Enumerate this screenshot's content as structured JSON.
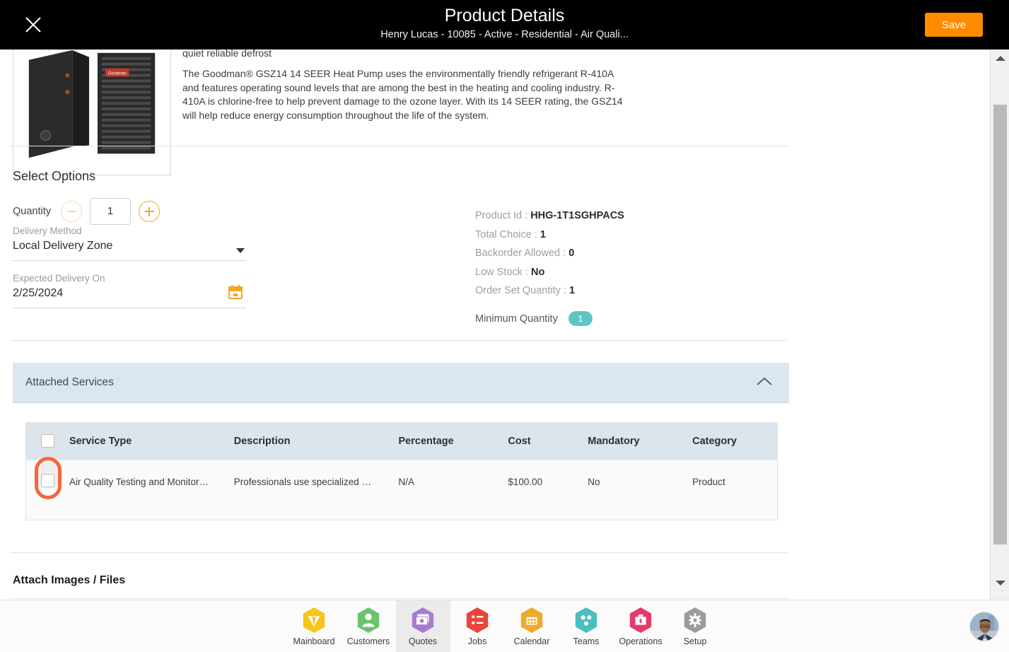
{
  "header": {
    "title": "Product Details",
    "subtitle": "Henry Lucas - 10085 - Active - Residential - Air Quali...",
    "close_icon": "close-icon",
    "save_label": "Save",
    "accent_color": "#ff8c00",
    "background": "#000000"
  },
  "product": {
    "description_clipped": "quiet reliable defrost",
    "description": "The Goodman® GSZ14 14 SEER Heat Pump uses the environmentally friendly refrigerant R-410A and features operating sound levels that are among the best in the heating and cooling industry. R-410A is chlorine-free to help prevent damage to the ozone layer. With its 14 SEER rating, the GSZ14 will help reduce energy consumption throughout the life of the system.",
    "image_alt": "heat-pump-condenser-photo"
  },
  "select_options": {
    "title": "Select Options",
    "quantity_label": "Quantity",
    "quantity_value": "1",
    "decrement_icon": "minus-icon",
    "increment_icon": "plus-icon",
    "delivery_method_label": "Delivery Method",
    "delivery_method_value": "Local Delivery Zone",
    "delivery_method_caret": "chevron-down-icon",
    "expected_delivery_label": "Expected Delivery On",
    "expected_delivery_value": "2/25/2024",
    "calendar_icon": "calendar-icon"
  },
  "info_panel": {
    "lines": [
      {
        "label": "Product Id :",
        "value": "HHG-1T1SGHPACS"
      },
      {
        "label": "Total Choice :",
        "value": "1"
      },
      {
        "label": "Backorder Allowed :",
        "value": "0"
      },
      {
        "label": "Low Stock :",
        "value": "No"
      },
      {
        "label": "Order Set Quantity :",
        "value": "1"
      }
    ],
    "minimum_quantity_label": "Minimum Quantity",
    "minimum_quantity_value": "1",
    "badge_color": "#5ec6c6"
  },
  "attached_services": {
    "section_title": "Attached Services",
    "collapse_icon": "chevron-up-icon",
    "header_color": "#dce6ef",
    "columns": [
      "Service Type",
      "Description",
      "Percentage",
      "Cost",
      "Mandatory",
      "Category"
    ],
    "rows": [
      {
        "service_type": "Air Quality Testing and Monitor…",
        "description": "Professionals use specialized …",
        "percentage": "N/A",
        "cost": "$100.00",
        "mandatory": "No",
        "category": "Product"
      }
    ],
    "highlight_color": "#f4663b"
  },
  "attachments": {
    "title": "Attach Images / Files"
  },
  "scrollbar": {
    "up_icon": "scroll-up-arrow-icon",
    "down_icon": "scroll-down-arrow-icon"
  },
  "bottom_nav": {
    "items": [
      {
        "label": "Mainboard",
        "icon": "mainboard-icon",
        "color": "#f5c518",
        "active": false
      },
      {
        "label": "Customers",
        "icon": "customers-icon",
        "color": "#6cc36c",
        "active": false
      },
      {
        "label": "Quotes",
        "icon": "quotes-icon",
        "color": "#a87ccc",
        "active": true
      },
      {
        "label": "Jobs",
        "icon": "jobs-icon",
        "color": "#e8453c",
        "active": false
      },
      {
        "label": "Calendar",
        "icon": "calendar-icon",
        "color": "#f0a92a",
        "active": false
      },
      {
        "label": "Teams",
        "icon": "teams-icon",
        "color": "#4dbdbd",
        "active": false
      },
      {
        "label": "Operations",
        "icon": "operations-icon",
        "color": "#e8396a",
        "active": false
      },
      {
        "label": "Setup",
        "icon": "setup-icon",
        "color": "#9b9b9b",
        "active": false
      }
    ],
    "avatar": "user-avatar"
  }
}
